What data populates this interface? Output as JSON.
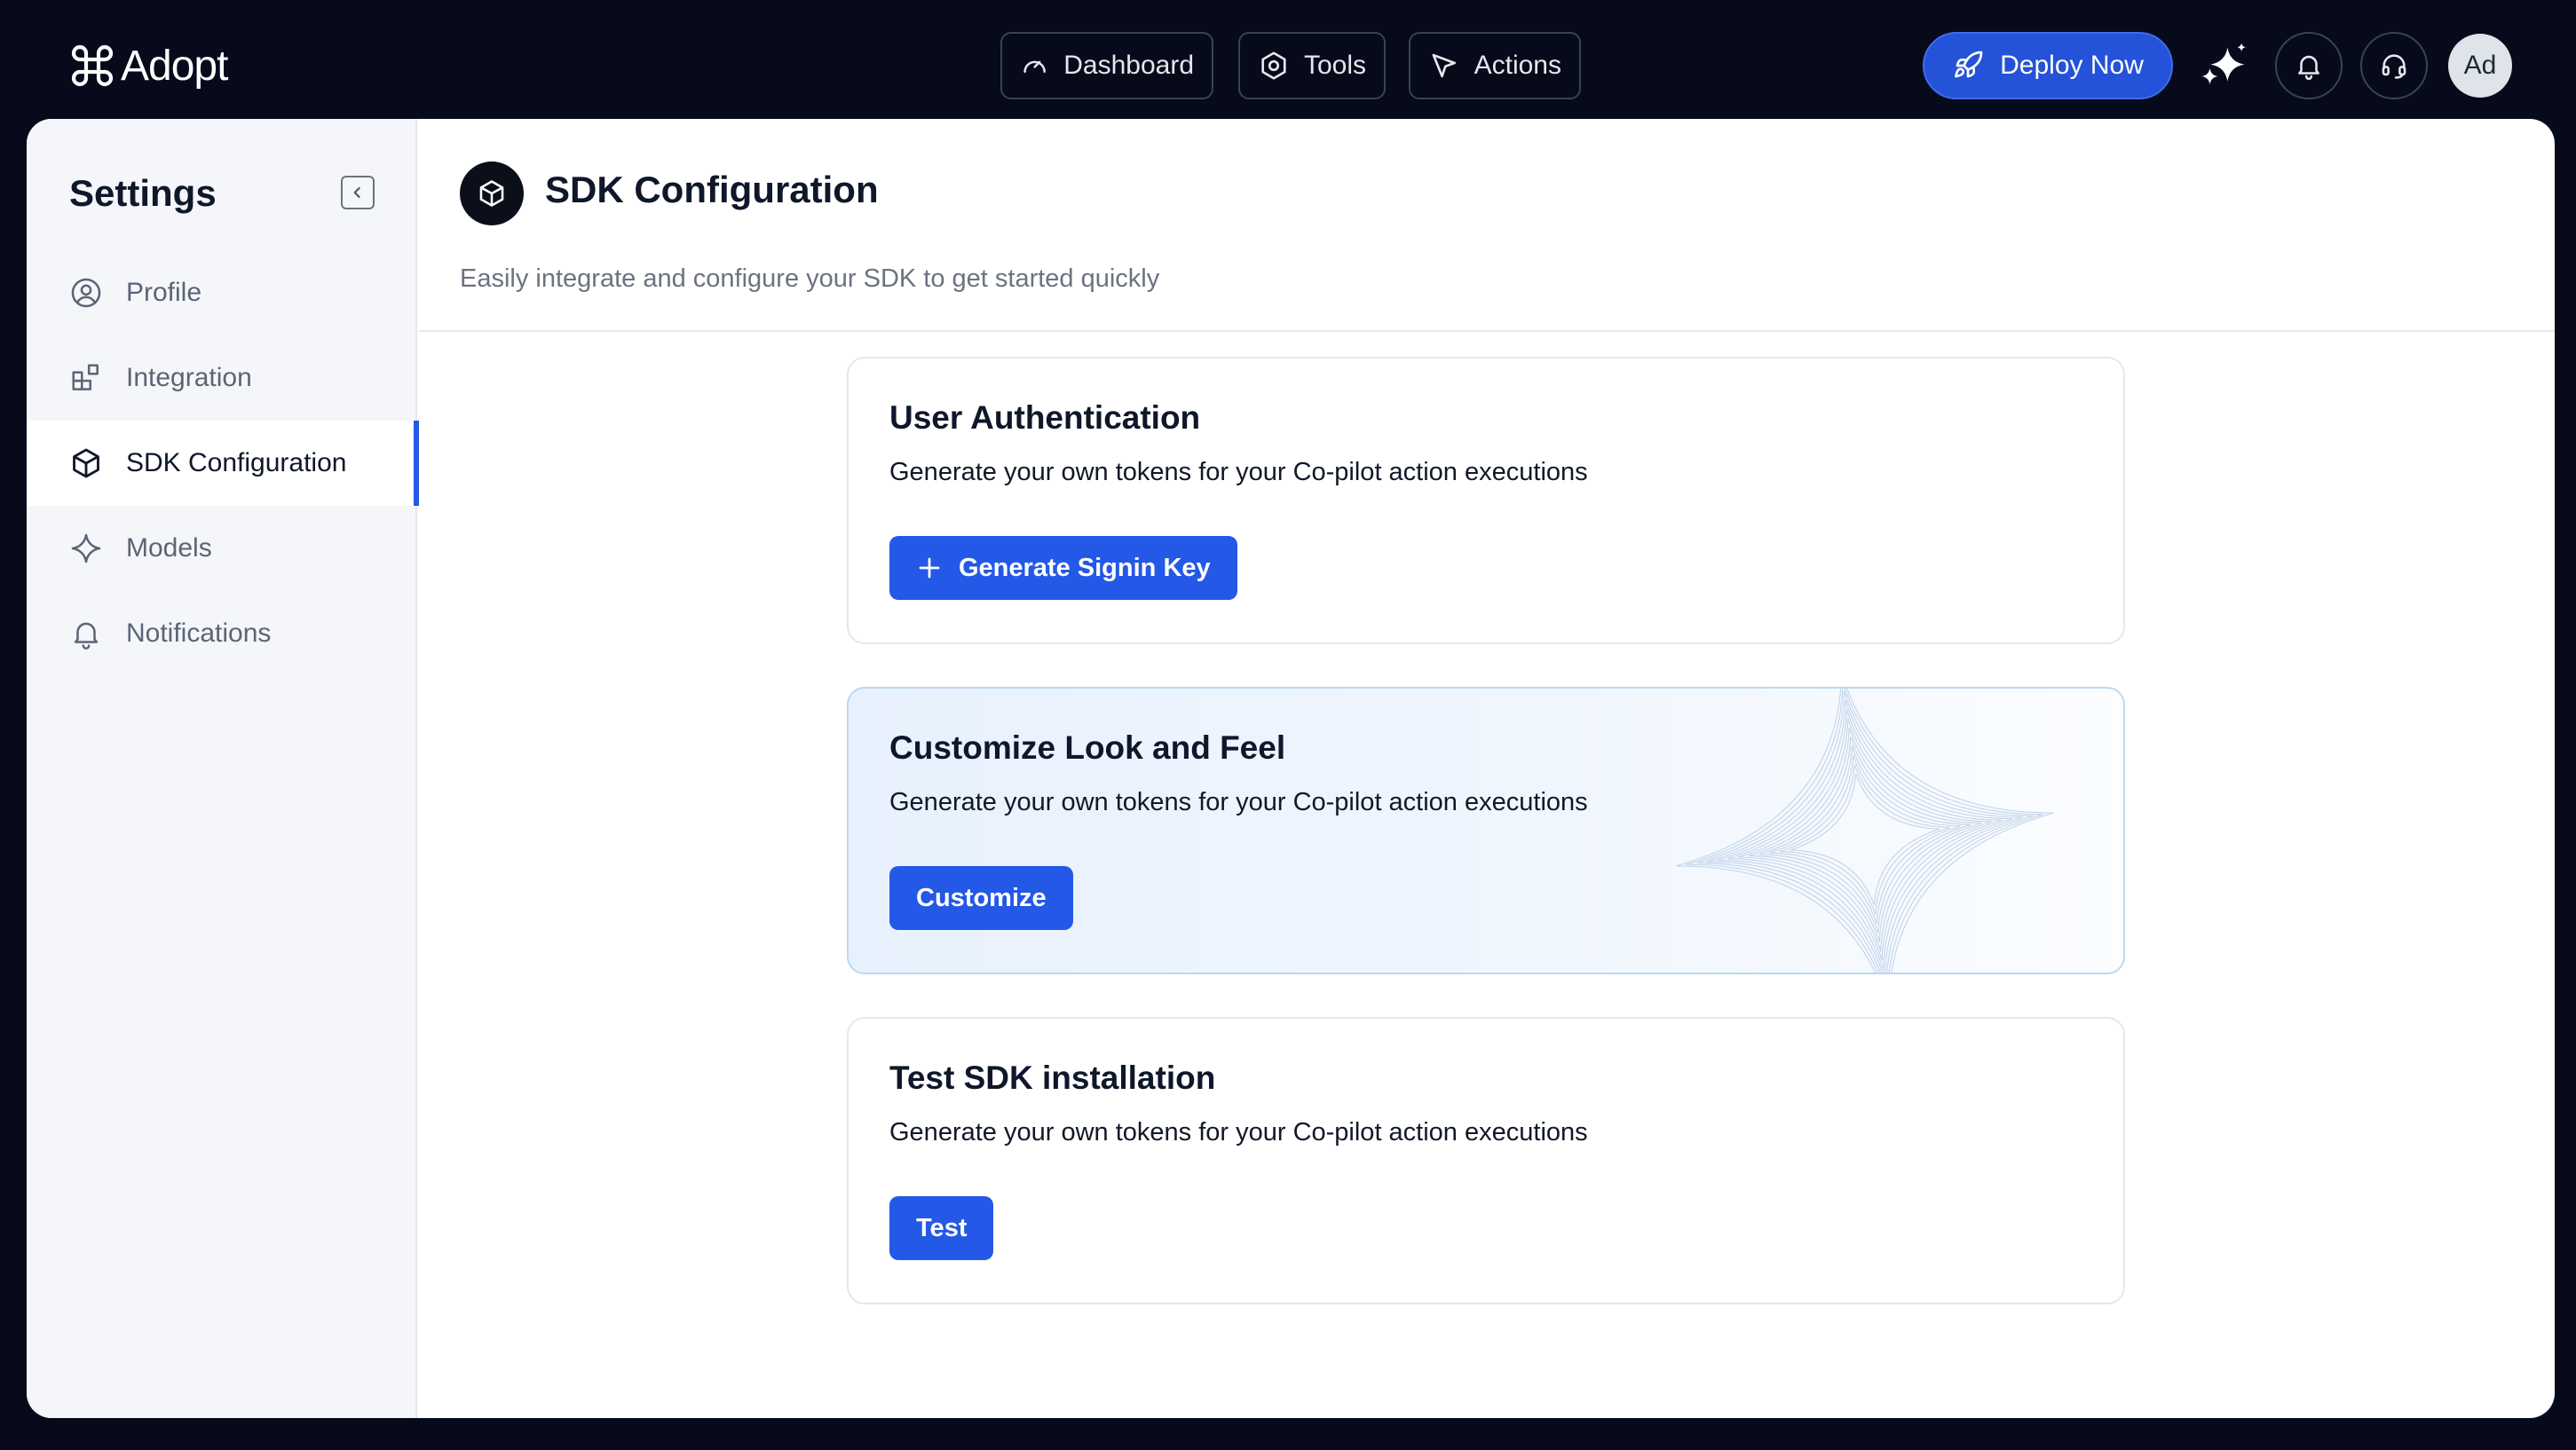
{
  "app": {
    "name": "Adopt"
  },
  "topnav": {
    "items": [
      {
        "label": "Dashboard",
        "icon": "gauge-icon"
      },
      {
        "label": "Tools",
        "icon": "hexagon-gear-icon"
      },
      {
        "label": "Actions",
        "icon": "cursor-arrow-icon"
      }
    ],
    "deploy_label": "Deploy Now",
    "avatar_initials": "Ad"
  },
  "sidebar": {
    "title": "Settings",
    "items": [
      {
        "label": "Profile",
        "icon": "user-circle-icon"
      },
      {
        "label": "Integration",
        "icon": "grid-plus-icon"
      },
      {
        "label": "SDK Configuration",
        "icon": "cube-icon",
        "active": true
      },
      {
        "label": "Models",
        "icon": "sparkle-icon"
      },
      {
        "label": "Notifications",
        "icon": "bell-icon"
      }
    ]
  },
  "page": {
    "title": "SDK Configuration",
    "subtitle": "Easily integrate and configure your SDK to get started quickly"
  },
  "cards": [
    {
      "title": "User Authentication",
      "description": "Generate your own tokens for your Co-pilot action executions",
      "button": "Generate Signin Key"
    },
    {
      "title": "Customize Look and Feel",
      "description": "Generate your own tokens for your Co-pilot action executions",
      "button": "Customize"
    },
    {
      "title": "Test SDK installation",
      "description": "Generate your own tokens for your Co-pilot action executions",
      "button": "Test"
    }
  ],
  "colors": {
    "topbar_bg": "#060a1a",
    "accent": "#2458e6",
    "sidebar_bg": "#f4f6f9"
  }
}
